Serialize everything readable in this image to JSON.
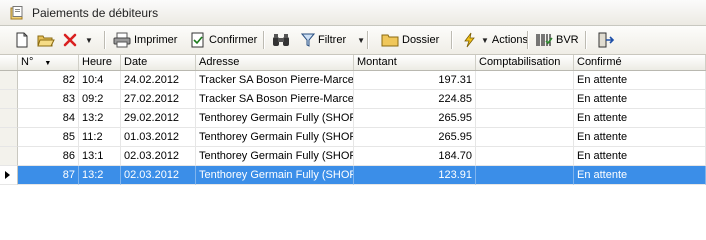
{
  "window": {
    "title": "Paiements de débiteurs"
  },
  "toolbar": {
    "print_label": "Imprimer",
    "confirm_label": "Confirmer",
    "filter_label": "Filtrer",
    "folder_label": "Dossier",
    "actions_label": "Actions",
    "bvr_label": "BVR"
  },
  "grid": {
    "columns": [
      "N°",
      "Heure",
      "Date",
      "Adresse",
      "Montant",
      "Comptabilisation",
      "Confirmé"
    ],
    "rows": [
      {
        "num": "82",
        "heure": "10:4",
        "date": "24.02.2012",
        "adresse": "Tracker SA Boson Pierre-Marcel",
        "montant": "197.31",
        "comptabilisation": "",
        "confirme": "En attente"
      },
      {
        "num": "83",
        "heure": "09:2",
        "date": "27.02.2012",
        "adresse": "Tracker SA Boson Pierre-Marcel",
        "montant": "224.85",
        "comptabilisation": "",
        "confirme": "En attente"
      },
      {
        "num": "84",
        "heure": "13:2",
        "date": "29.02.2012",
        "adresse": "Tenthorey Germain Fully (SHOP-",
        "montant": "265.95",
        "comptabilisation": "",
        "confirme": "En attente"
      },
      {
        "num": "85",
        "heure": "11:2",
        "date": "01.03.2012",
        "adresse": "Tenthorey Germain Fully (SHOP-",
        "montant": "265.95",
        "comptabilisation": "",
        "confirme": "En attente"
      },
      {
        "num": "86",
        "heure": "13:1",
        "date": "02.03.2012",
        "adresse": "Tenthorey Germain Fully (SHOP-",
        "montant": "184.70",
        "comptabilisation": "",
        "confirme": "En attente"
      },
      {
        "num": "87",
        "heure": "13:2",
        "date": "02.03.2012",
        "adresse": "Tenthorey Germain Fully (SHOP-",
        "montant": "123.91",
        "comptabilisation": "",
        "confirme": "En attente"
      }
    ],
    "selected_row": 5
  },
  "colors": {
    "selection": "#3b8ee8",
    "delete_icon": "#d92020"
  }
}
